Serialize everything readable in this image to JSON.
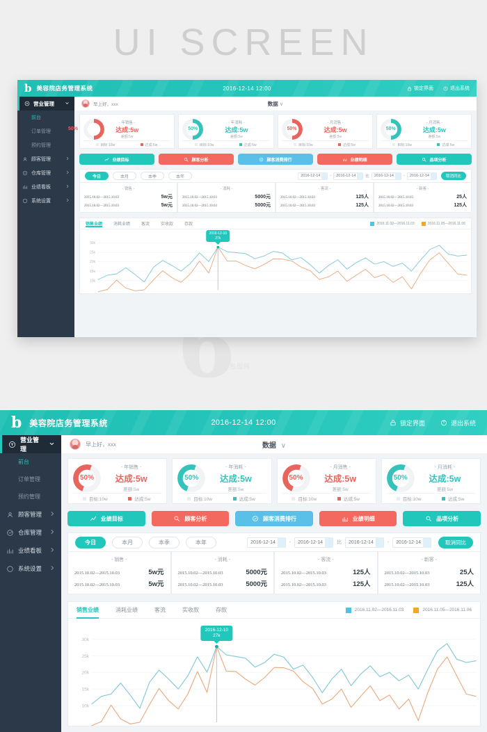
{
  "banner": {
    "title": "UI SCREEN"
  },
  "header": {
    "logo": "b",
    "title": "美容院店务管理系统",
    "clock": "2016-12-14 12:00",
    "actions": [
      {
        "label": "锁定界面",
        "icon": "lock-icon"
      },
      {
        "label": "退出系统",
        "icon": "power-icon"
      }
    ]
  },
  "sidebar": {
    "group": {
      "label": "营业管理",
      "icon": "store-icon",
      "caret": "chevron-down-icon"
    },
    "subitems": [
      {
        "label": "前台",
        "active": true
      },
      {
        "label": "订单管理",
        "active": false
      },
      {
        "label": "预约管理",
        "active": false
      }
    ],
    "items": [
      {
        "label": "顾客管理",
        "icon": "customer-icon",
        "caret": "chevron-right-icon"
      },
      {
        "label": "仓库管理",
        "icon": "warehouse-icon",
        "caret": "chevron-right-icon"
      },
      {
        "label": "业绩看板",
        "icon": "dashboard-icon",
        "caret": "chevron-right-icon"
      },
      {
        "label": "系统设置",
        "icon": "settings-icon",
        "caret": "chevron-right-icon"
      }
    ]
  },
  "greeting": {
    "avatar": "avatar",
    "text": "早上好，xxx",
    "center_label": "数据",
    "center_caret": "∨"
  },
  "kpis": [
    {
      "percent": "50%",
      "category": "- 年销售 -",
      "done": "达成:5w",
      "gap": "差额:5w",
      "target_label": "目标:10w",
      "done_label": "达成:5w",
      "color": "#e8655f",
      "ring_bg": "#f1f3f5"
    },
    {
      "percent": "50%",
      "category": "- 年消耗 -",
      "done": "达成:5w",
      "gap": "差额:5w",
      "target_label": "目标:10w",
      "done_label": "达成:5w",
      "color": "#35c2bb",
      "ring_bg": "#f1f3f5"
    },
    {
      "percent": "50%",
      "category": "- 月消售 -",
      "done": "达成:5w",
      "gap": "差额:5w",
      "target_label": "目标:10w",
      "done_label": "达成:5w",
      "color": "#e8655f",
      "ring_bg": "#f1f3f5"
    },
    {
      "percent": "50%",
      "category": "- 月消耗 -",
      "done": "达成:5w",
      "gap": "差额:5w",
      "target_label": "目标:10w",
      "done_label": "达成:5w",
      "color": "#35c2bb",
      "ring_bg": "#f1f3f5"
    }
  ],
  "actions": [
    {
      "label": "业绩目标",
      "icon": "chart-line-icon",
      "color": "#21c7bb"
    },
    {
      "label": "顾客分析",
      "icon": "user-search-icon",
      "color": "#f4695f"
    },
    {
      "label": "顾客消费排行",
      "icon": "medal-icon",
      "color": "#5bc0e8"
    },
    {
      "label": "业绩明细",
      "icon": "bar-chart-icon",
      "color": "#f4695f"
    },
    {
      "label": "品项分析",
      "icon": "search-icon",
      "color": "#21c7bb"
    }
  ],
  "filters": {
    "pills": [
      {
        "label": "今日",
        "active": true
      },
      {
        "label": "本月",
        "active": false
      },
      {
        "label": "本季",
        "active": false
      },
      {
        "label": "本年",
        "active": false
      }
    ],
    "date_from_1": "2016-12-14",
    "date_to_1": "2016-12-14",
    "compare_word": "比",
    "date_from_2": "2016-12-14",
    "date_to_2": "2016-12-14",
    "range_sep": "-",
    "compare_button": "取消同比"
  },
  "stats": [
    {
      "category": "- 销售 -",
      "rows": [
        {
          "range": "2015.10.02—2015.10.03",
          "value": "5w元"
        },
        {
          "range": "2015.10.02—2015.10.03",
          "value": "5w元"
        }
      ]
    },
    {
      "category": "- 消耗 -",
      "rows": [
        {
          "range": "2015.10.02—2015.10.03",
          "value": "5000元"
        },
        {
          "range": "2015.10.02—2015.10.03",
          "value": "5000元"
        }
      ]
    },
    {
      "category": "- 客流 -",
      "rows": [
        {
          "range": "2015.10.02—2015.10.03",
          "value": "125人"
        },
        {
          "range": "2015.10.02—2015.10.03",
          "value": "125人"
        }
      ]
    },
    {
      "category": "- 新客 -",
      "rows": [
        {
          "range": "2015.10.02—2015.10.03",
          "value": "25人"
        },
        {
          "range": "2015.10.02—2015.10.03",
          "value": "125人"
        }
      ]
    }
  ],
  "chart_tabs": [
    {
      "label": "销售业绩",
      "active": true
    },
    {
      "label": "消耗业绩",
      "active": false
    },
    {
      "label": "客流",
      "active": false
    },
    {
      "label": "实收款",
      "active": false
    },
    {
      "label": "存款",
      "active": false
    }
  ],
  "chart_data": {
    "type": "line",
    "title": "销售业绩",
    "xlabel": "",
    "ylabel": "",
    "ylim": [
      5000,
      32000
    ],
    "yticks": [
      "10k",
      "15k",
      "20k",
      "25k",
      "30k"
    ],
    "ytick_values": [
      10000,
      15000,
      20000,
      25000,
      30000
    ],
    "grid": true,
    "legend_position": "top-right",
    "tooltip": {
      "date": "2016-12-10",
      "value": "27k",
      "point_index": 13
    },
    "series": [
      {
        "name": "2016.11.02—2016.11.03",
        "color": "#7ec6d8",
        "values": [
          10500,
          12800,
          13500,
          16800,
          13200,
          9200,
          17000,
          20700,
          18000,
          15000,
          19000,
          24700,
          20100,
          27800,
          25300,
          24800,
          24300,
          21600,
          23000,
          25500,
          24600,
          21000,
          22200,
          18500,
          13900,
          18000,
          21000,
          16000,
          19500,
          22000,
          18700,
          20000,
          17500,
          19200,
          15000,
          21000,
          26500,
          28700,
          24000,
          23000,
          23500
        ]
      },
      {
        "name": "2016.11.05—2016.11.06",
        "color": "#e8a87c",
        "values": [
          4000,
          5200,
          10200,
          6000,
          4500,
          5000,
          10300,
          15200,
          11500,
          9000,
          13500,
          20300,
          14000,
          27800,
          20400,
          20300,
          18000,
          16200,
          18500,
          21500,
          21400,
          20400,
          17200,
          15200,
          10500,
          12000,
          15000,
          9500,
          12800,
          16000,
          11500,
          13200,
          9000,
          12000,
          5500,
          14000,
          21000,
          24700,
          19000,
          13500,
          12800
        ]
      }
    ],
    "legend": [
      {
        "label": "2016.11.02—2016.11.03",
        "color": "#4fc3e0"
      },
      {
        "label": "2016.11.05—2016.11.06",
        "color": "#f5a623"
      }
    ]
  }
}
